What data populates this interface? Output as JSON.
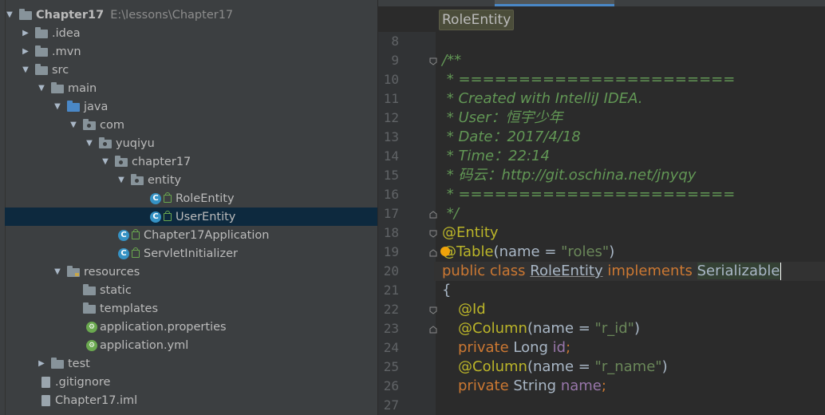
{
  "tree": {
    "project_name": "Chapter17",
    "project_path": "E:\\lessons\\Chapter17",
    "items": [
      {
        "label": "Chapter17",
        "path": "E:\\lessons\\Chapter17",
        "depth": 0,
        "expanded": true,
        "icon": "folder-icon"
      },
      {
        "label": ".idea",
        "depth": 1,
        "expanded": false,
        "icon": "folder-icon"
      },
      {
        "label": ".mvn",
        "depth": 1,
        "expanded": false,
        "icon": "folder-icon"
      },
      {
        "label": "src",
        "depth": 1,
        "expanded": true,
        "icon": "folder-icon"
      },
      {
        "label": "main",
        "depth": 2,
        "expanded": true,
        "icon": "folder-icon"
      },
      {
        "label": "java",
        "depth": 3,
        "expanded": true,
        "icon": "source-folder-icon"
      },
      {
        "label": "com",
        "depth": 4,
        "expanded": true,
        "icon": "package-icon"
      },
      {
        "label": "yuqiyu",
        "depth": 5,
        "expanded": true,
        "icon": "package-icon"
      },
      {
        "label": "chapter17",
        "depth": 6,
        "expanded": true,
        "icon": "package-icon"
      },
      {
        "label": "entity",
        "depth": 7,
        "expanded": true,
        "icon": "package-icon"
      },
      {
        "label": "RoleEntity",
        "depth": 8,
        "icon": "class-icon"
      },
      {
        "label": "UserEntity",
        "depth": 8,
        "icon": "class-icon",
        "selected": true
      },
      {
        "label": "Chapter17Application",
        "depth": 7,
        "icon": "spring-class-icon"
      },
      {
        "label": "ServletInitializer",
        "depth": 7,
        "icon": "class-icon"
      },
      {
        "label": "resources",
        "depth": 3,
        "expanded": true,
        "icon": "resources-folder-icon"
      },
      {
        "label": "static",
        "depth": 4,
        "icon": "folder-icon"
      },
      {
        "label": "templates",
        "depth": 4,
        "icon": "folder-icon"
      },
      {
        "label": "application.properties",
        "depth": 4,
        "icon": "spring-config-icon"
      },
      {
        "label": "application.yml",
        "depth": 4,
        "icon": "spring-config-icon"
      },
      {
        "label": "test",
        "depth": 2,
        "expanded": false,
        "icon": "folder-icon"
      },
      {
        "label": ".gitignore",
        "depth": 2,
        "icon": "file-icon"
      },
      {
        "label": "Chapter17.iml",
        "depth": 2,
        "icon": "file-icon"
      }
    ]
  },
  "editor": {
    "breadcrumb": "RoleEntity",
    "line_numbers": [
      "8",
      "9",
      "10",
      "11",
      "12",
      "13",
      "14",
      "15",
      "16",
      "17",
      "18",
      "19",
      "20",
      "21",
      "22",
      "23",
      "24",
      "25",
      "26",
      "27"
    ],
    "lines": {
      "l9": "/**",
      "l10": " * =======================",
      "l11": " * Created with IntelliJ IDEA.",
      "l12": " * User：恒宇少年",
      "l13": " * Date：2017/4/18",
      "l14": " * Time：22:14",
      "l15": " * 码云：http://git.oschina.net/jnyqy",
      "l16": " * =======================",
      "l17": " */",
      "l18_ann": "@Entity",
      "l19_ann": "@Table",
      "l19_a": "(",
      "l19_name": "name",
      "l19_eq": " = ",
      "l19_str": "\"roles\"",
      "l19_b": ")",
      "l20_kw": "public class ",
      "l20_cls": "RoleEntity",
      "l20_impl": " implements ",
      "l20_iface": "Serializable",
      "l21": "{",
      "l22_ann": "@Id",
      "l23_ann": "@Column",
      "l23_a": "(",
      "l23_name": "name",
      "l23_eq": " = ",
      "l23_str": "\"r_id\"",
      "l23_b": ")",
      "l24_kw": "private ",
      "l24_type": "Long ",
      "l24_fld": "id",
      "l24_end": ";",
      "l25_ann": "@Column",
      "l25_a": "(",
      "l25_name": "name",
      "l25_eq": " = ",
      "l25_str": "\"r_name\"",
      "l25_b": ")",
      "l26_kw": "private ",
      "l26_type": "String ",
      "l26_fld": "name",
      "l26_end": ";"
    }
  },
  "colors": {
    "tree_bg": "#3c3f41",
    "selection": "#0d293e",
    "editor_bg": "#2b2b2b",
    "comment": "#629755",
    "annotation": "#bbb529",
    "keyword": "#cc7832",
    "string": "#6a8759"
  }
}
